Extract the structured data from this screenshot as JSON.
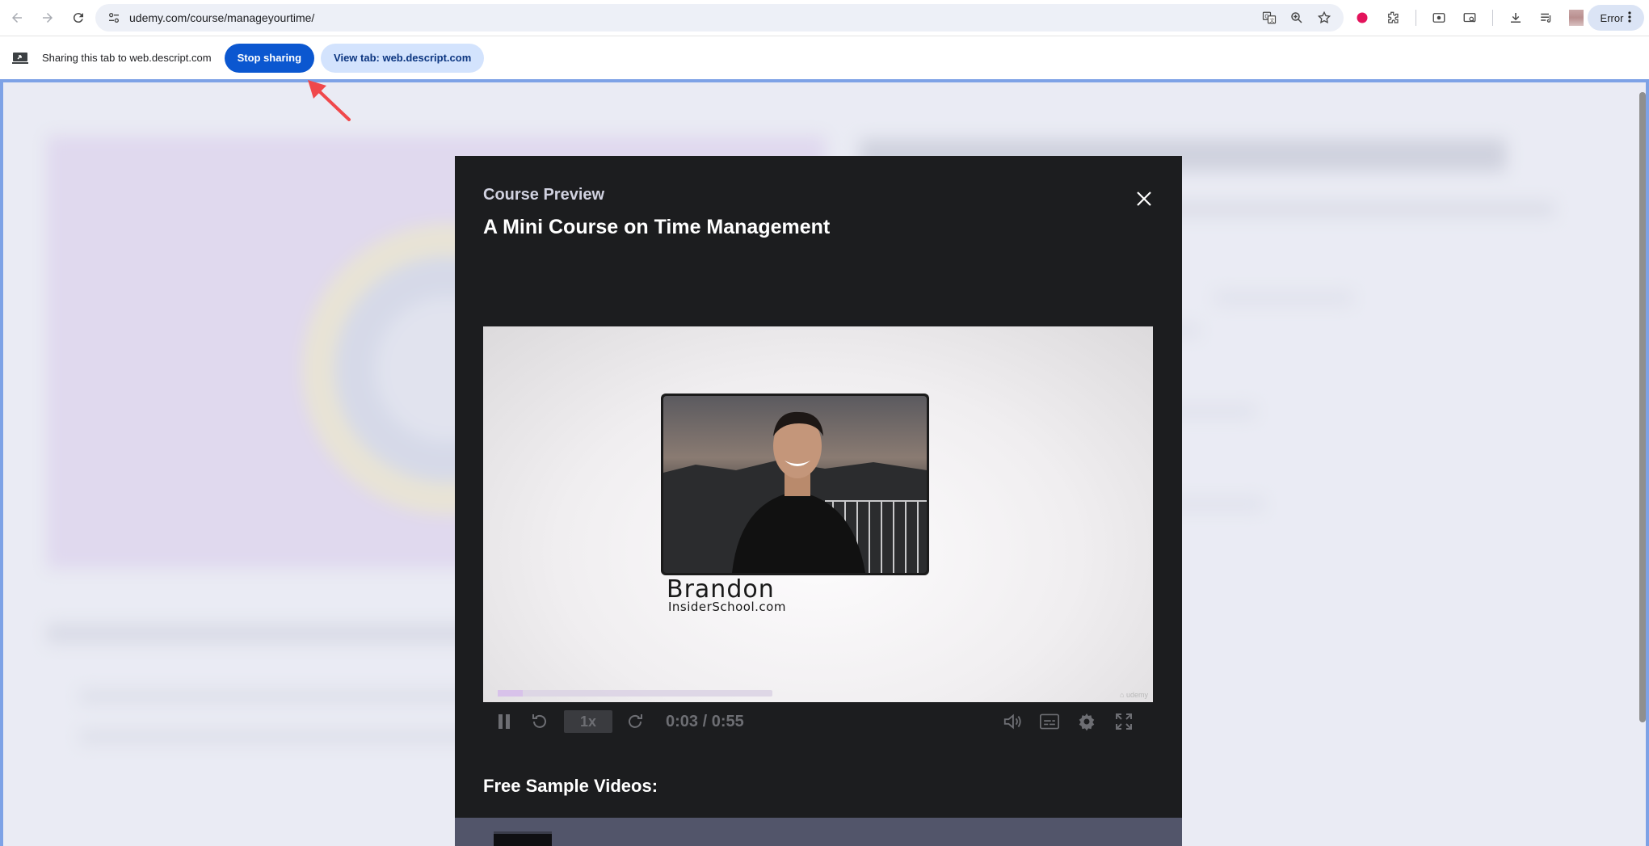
{
  "browser": {
    "url": "udemy.com/course/manageyourtime/",
    "profile_chip_label": "Error",
    "nav_icons": [
      "back-arrow-icon",
      "forward-arrow-icon",
      "reload-icon"
    ],
    "omnibox_icons": [
      "translate-icon",
      "zoom-icon",
      "star-icon"
    ],
    "extension_icons": [
      "record-dot-icon",
      "puzzle-icon",
      "screen-capture-icon",
      "cast-icon",
      "download-icon",
      "media-queue-icon"
    ]
  },
  "sharing_bar": {
    "message": "Sharing this tab to web.descript.com",
    "stop_label": "Stop sharing",
    "view_label": "View tab: web.descript.com",
    "primary_color": "#0b57d0"
  },
  "modal": {
    "eyebrow": "Course Preview",
    "title": "A Mini Course on Time Management",
    "video": {
      "presenter_name": "Brandon",
      "presenter_site": "InsiderSchool.com",
      "progress_fraction": 0.09,
      "speed_label": "1x",
      "time_display": "0:03 / 0:55",
      "control_icons": [
        "pause-icon",
        "rewind-icon",
        "forward-icon",
        "volume-icon",
        "captions-icon",
        "settings-gear-icon",
        "fullscreen-icon"
      ]
    },
    "samples_heading": "Free Sample Videos:"
  },
  "colors": {
    "modal_bg": "#1c1d1f",
    "share_frame": "#7ea2e6",
    "annotation_arrow": "#f0484b"
  }
}
